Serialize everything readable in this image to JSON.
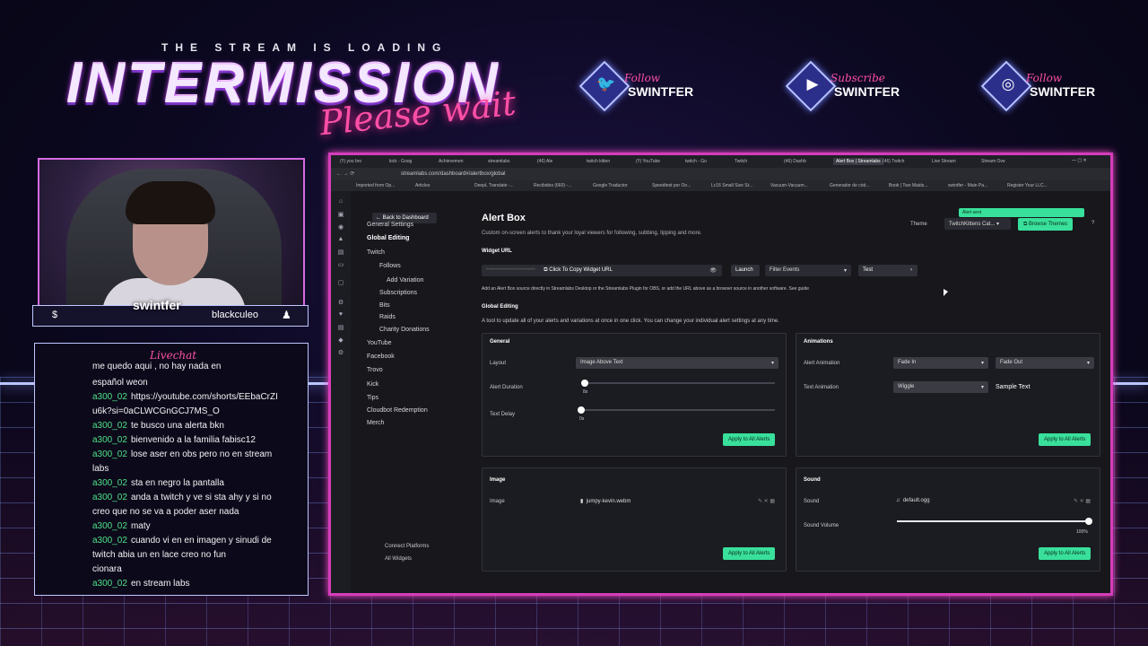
{
  "overlay": {
    "subtitle": "THE STREAM IS LOADING",
    "title": "INTERMISSION",
    "script_text": "Please wait",
    "socials": [
      {
        "icon": "twitter-icon",
        "small": "Follow",
        "name": "SWINTFER"
      },
      {
        "icon": "youtube-icon",
        "small": "Subscribe",
        "name": "SWINTFER"
      },
      {
        "icon": "instagram-icon",
        "small": "Follow",
        "name": "SWINTFER"
      }
    ],
    "streamer_name": "swintfer",
    "viewer_name": "blackculeo",
    "badge_left": "$",
    "badge_right": "♟"
  },
  "chat": {
    "title": "Livechat",
    "messages": [
      {
        "user": "",
        "text": "me quedo aqui , no hay nada en"
      },
      {
        "user": "",
        "text": "español weon"
      },
      {
        "user": "a300_02",
        "text": "https://youtube.com/shorts/EEbaCrZI"
      },
      {
        "user": "",
        "text": "u6k?si=0aCLWCGnGCJ7MS_O"
      },
      {
        "user": "a300_02",
        "text": "te busco una alerta bkn"
      },
      {
        "user": "a300_02",
        "text": "bienvenido a la familia fabisc12"
      },
      {
        "user": "a300_02",
        "text": "lose aser en obs pero no en stream"
      },
      {
        "user": "",
        "text": "labs"
      },
      {
        "user": "a300_02",
        "text": "sta en negro la pantalla"
      },
      {
        "user": "a300_02",
        "text": "anda a twitch y ve si sta ahy y si no"
      },
      {
        "user": "",
        "text": "creo que no se va a poder aser nada"
      },
      {
        "user": "a300_02",
        "text": "maty"
      },
      {
        "user": "a300_02",
        "text": "cuando vi en en imagen y sinudi de"
      },
      {
        "user": "",
        "text": "twitch abia un en lace creo no fun"
      },
      {
        "user": "",
        "text": "cionara"
      },
      {
        "user": "a300_02",
        "text": "en stream labs"
      }
    ]
  },
  "browser": {
    "tabs": [
      "(!!) you bro",
      "kick - Goog",
      "Achievemen",
      "streamlabs",
      "(46) Ale",
      "twitch kitten",
      "(!!) YouTube",
      "twitch - Go",
      "Twitch",
      "(46) Dashb",
      "Alert Box | Streamlabs",
      "(46) Twitch",
      "Live Stream",
      "Stream Ove"
    ],
    "url": "streamlabs.com/dashboard#/alertbox/global",
    "bookmarks": [
      "Imported from Op...",
      "Articles",
      "DeepL Translate -...",
      "Recibidos (660) -...",
      "Google Traductor",
      "Speedtest por Oo...",
      "Lc16 Small Size St...",
      "Vacuum-Vacuum...",
      "Generador de cód...",
      "Book | Two Maids...",
      "swintfer - Main Pa...",
      "Register Your LLC..."
    ],
    "back_label": "Back to Dashboard",
    "nav": [
      {
        "label": "General Settings"
      },
      {
        "label": "Global Editing",
        "active": true
      },
      {
        "label": "Twitch"
      },
      {
        "label": "Follows"
      },
      {
        "label": "Add Variation"
      },
      {
        "label": "Subscriptions"
      },
      {
        "label": "Bits"
      },
      {
        "label": "Raids"
      },
      {
        "label": "Charity Donations"
      },
      {
        "label": "YouTube"
      },
      {
        "label": "Facebook"
      },
      {
        "label": "Trovo"
      },
      {
        "label": "Kick"
      },
      {
        "label": "Tips"
      },
      {
        "label": "Cloudbot Redemption"
      },
      {
        "label": "Merch"
      }
    ],
    "connect_platforms": "Connect Platforms",
    "all_widgets": "All Widgets"
  },
  "alertbox": {
    "title": "Alert Box",
    "description": "Custom on-screen alerts to thank your loyal viewers for following, subbing, tipping and more.",
    "theme_label": "Theme",
    "theme_value": "TwitchKittens Cat...",
    "browse_themes": "Browse Themes",
    "alert_sent": "Alert sent",
    "widget_url_label": "Widget URL",
    "copy_url": "Click To Copy Widget URL",
    "launch": "Launch",
    "filter_events": "Filter Events",
    "test": "Test",
    "hint": "Add an Alert Box source directly in Streamlabs Desktop or the Streamlabs Plugin for OBS, or add the URL above as a browser source in another software. See guide",
    "global_editing_title": "Global Editing",
    "global_editing_desc": "A tool to update all of your alerts and variations at once in one click. You can change your individual alert settings at any time.",
    "general": {
      "title": "General",
      "layout_label": "Layout",
      "layout_value": "Image Above Text",
      "duration_label": "Alert Duration",
      "duration_value": "8s",
      "delay_label": "Text Delay",
      "delay_value": "0s",
      "apply": "Apply to All Alerts"
    },
    "animations": {
      "title": "Animations",
      "alert_anim_label": "Alert Animation",
      "alert_in": "Fade In",
      "alert_out": "Fade Out",
      "text_anim_label": "Text Animation",
      "text_anim_value": "Wiggle",
      "sample": "Sample Text",
      "apply": "Apply to All Alerts"
    },
    "image": {
      "title": "Image",
      "label": "Image",
      "file": "jumpy-kevin.webm",
      "apply": "Apply to All Alerts"
    },
    "sound": {
      "title": "Sound",
      "label": "Sound",
      "file": "default.ogg",
      "volume_label": "Sound Volume",
      "volume_value": "100%",
      "apply": "Apply to All Alerts"
    }
  }
}
